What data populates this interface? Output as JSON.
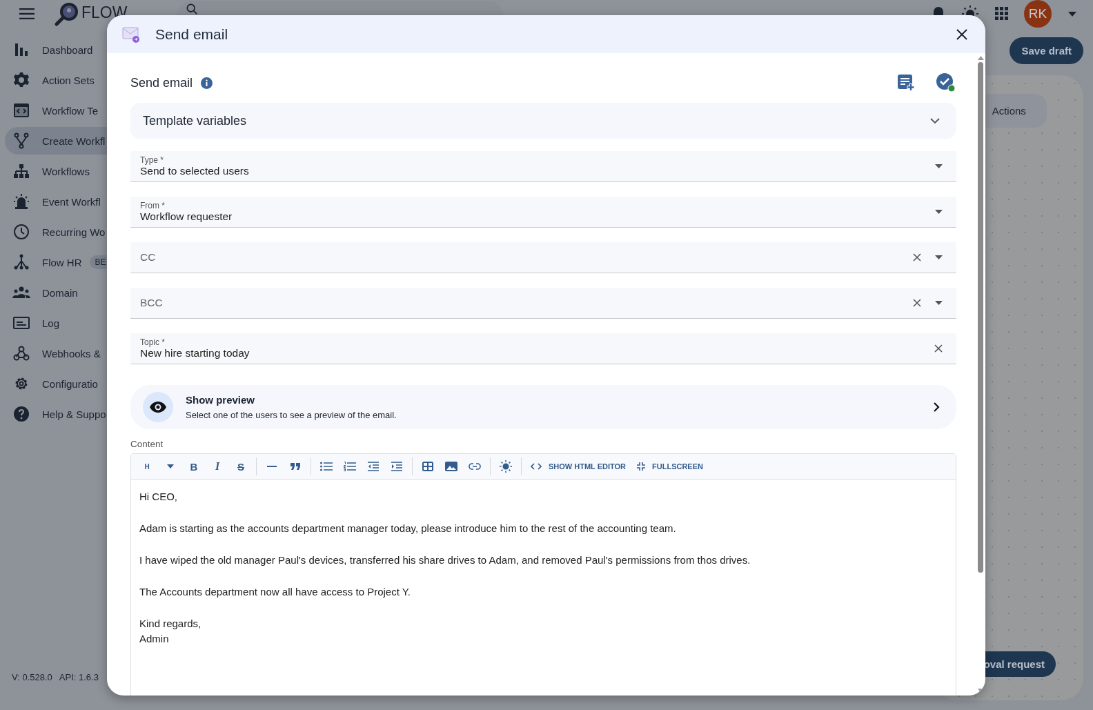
{
  "topbar": {
    "logo": "FLOW",
    "search": {
      "kind": "pill"
    },
    "avatar": "RK"
  },
  "sidebar": {
    "items": [
      {
        "label": "Dashboard",
        "selected": false
      },
      {
        "label": "Action Sets",
        "selected": false
      },
      {
        "label": "Workflow Te",
        "selected": false
      },
      {
        "label": "Create Workfl",
        "selected": true
      },
      {
        "label": "Workflows",
        "selected": false
      },
      {
        "label": "Event Workfl",
        "selected": false
      },
      {
        "label": "Recurring Wo",
        "selected": false
      },
      {
        "label": "Flow HR",
        "badge": "BE",
        "selected": false
      },
      {
        "label": "Domain",
        "selected": false
      },
      {
        "label": "Log",
        "selected": false
      },
      {
        "label": "Webhooks &",
        "selected": false
      },
      {
        "label": "Configuratio",
        "selected": false
      },
      {
        "label": "Help & Suppo",
        "selected": false
      }
    ],
    "version": "V: 0.528.0",
    "api": "API: 1.6.3"
  },
  "page": {
    "save_button": "Save draft",
    "tab": "Actions",
    "submit_button": "oval request"
  },
  "dialog": {
    "title": "Send email",
    "section_title": "Send email",
    "accordion": {
      "label": "Template variables",
      "expanded": false
    },
    "fields": [
      {
        "label": "Type *",
        "value": "Send to selected users",
        "clearable": false,
        "dropdown": true
      },
      {
        "label": "From *",
        "value": "Workflow requester",
        "clearable": false,
        "dropdown": true
      },
      {
        "placeholder": "CC",
        "clearable": true,
        "dropdown": true
      },
      {
        "placeholder": "BCC",
        "clearable": true,
        "dropdown": true
      },
      {
        "label": "Topic *",
        "value": "New hire starting today",
        "clearable": true,
        "dropdown": false
      }
    ],
    "preview": {
      "title": "Show preview",
      "subtitle": "Select one of the users to see a preview of the email."
    },
    "content_label": "Content",
    "toolbar": [
      {
        "kind": "heading",
        "label": "H"
      },
      {
        "kind": "caret"
      },
      {
        "kind": "bold",
        "label": "B"
      },
      {
        "kind": "italic",
        "label": "I"
      },
      {
        "kind": "strike",
        "label": "S"
      },
      {
        "kind": "divider"
      },
      {
        "kind": "rule"
      },
      {
        "kind": "quote"
      },
      {
        "kind": "divider"
      },
      {
        "kind": "bullets"
      },
      {
        "kind": "numbers"
      },
      {
        "kind": "outdent"
      },
      {
        "kind": "indent"
      },
      {
        "kind": "divider"
      },
      {
        "kind": "table"
      },
      {
        "kind": "image"
      },
      {
        "kind": "link"
      },
      {
        "kind": "divider"
      },
      {
        "kind": "theme"
      },
      {
        "kind": "divider"
      },
      {
        "kind": "html",
        "label": "SHOW HTML EDITOR"
      },
      {
        "kind": "fullscreen",
        "label": "FULLSCREEN"
      }
    ],
    "paragraphs": [
      {
        "lines": [
          "Hi CEO,"
        ]
      },
      {
        "lines": [
          "Adam is starting as the accounts department manager today, please introduce him to the rest of the accounting team."
        ]
      },
      {
        "lines": [
          "I have wiped the old manager Paul's devices, transferred his share drives to Adam, and removed Paul's permissions from thos drives."
        ]
      },
      {
        "lines": [
          "The Accounts department now all have access to Project Y."
        ]
      },
      {
        "lines": [
          "Kind regards,",
          "Admin"
        ]
      }
    ]
  }
}
